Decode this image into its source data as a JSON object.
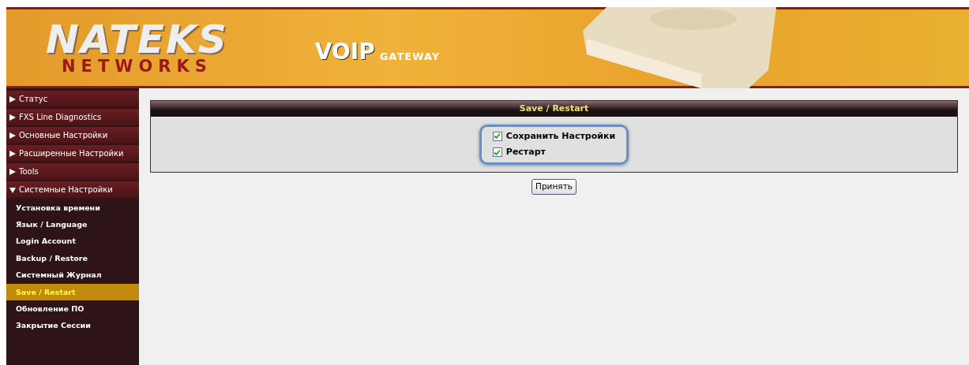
{
  "header": {
    "logo_main": "NATEKS",
    "logo_sub": "NETWORKS",
    "product_main": "VOIP",
    "product_sub": "GATEWAY"
  },
  "sidebar": {
    "items": [
      {
        "label": "Статус",
        "expanded": false
      },
      {
        "label": "FXS Line Diagnostics",
        "expanded": false
      },
      {
        "label": "Основные Настройки",
        "expanded": false
      },
      {
        "label": "Расширенные Настройки",
        "expanded": false
      },
      {
        "label": "Tools",
        "expanded": false
      },
      {
        "label": "Системные Настройки",
        "expanded": true,
        "children": [
          {
            "label": "Установка времени",
            "selected": false
          },
          {
            "label": "Язык / Language",
            "selected": false
          },
          {
            "label": "Login Account",
            "selected": false
          },
          {
            "label": "Backup / Restore",
            "selected": false
          },
          {
            "label": "Системный Журнал",
            "selected": false
          },
          {
            "label": "Save / Restart",
            "selected": true
          },
          {
            "label": "Обновление ПО",
            "selected": false
          },
          {
            "label": "Закрытие Сессии",
            "selected": false
          }
        ]
      }
    ]
  },
  "panel": {
    "title": "Save / Restart",
    "options": [
      {
        "label": "Сохранить Настройки",
        "checked": true
      },
      {
        "label": "Рестарт",
        "checked": true
      }
    ]
  },
  "apply_button": "Принять"
}
